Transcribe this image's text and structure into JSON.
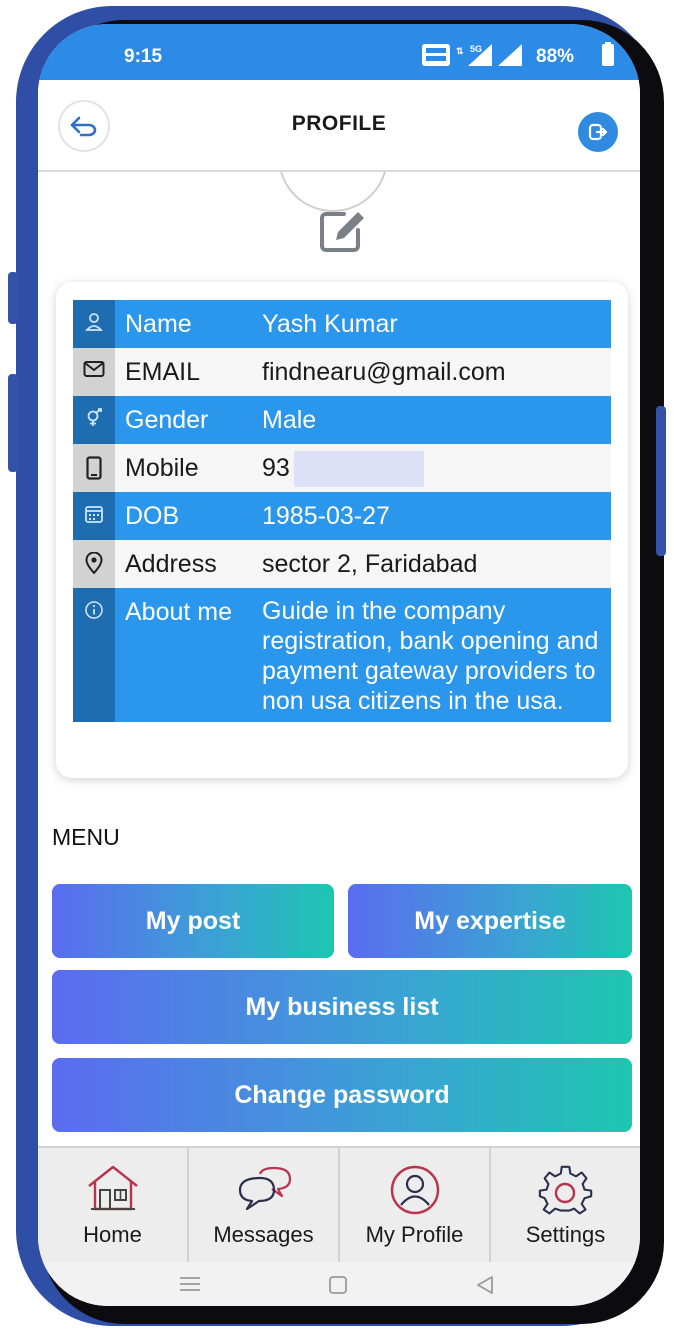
{
  "status_bar": {
    "time": "9:15",
    "network_label": "5G",
    "battery": "88%"
  },
  "header": {
    "title": "PROFILE"
  },
  "profile": {
    "rows": [
      {
        "label": "Name",
        "value": "Yash Kumar",
        "icon": "person-icon"
      },
      {
        "label": "EMAIL",
        "value": "findnearu@gmail.com",
        "icon": "mail-icon"
      },
      {
        "label": "Gender",
        "value": "Male",
        "icon": "gender-icon"
      },
      {
        "label": "Mobile",
        "value": "93",
        "icon": "phone-icon"
      },
      {
        "label": "DOB",
        "value": "1985-03-27",
        "icon": "calendar-icon"
      },
      {
        "label": "Address",
        "value": "sector 2, Faridabad",
        "icon": "location-pin-icon"
      },
      {
        "label": "About me",
        "value": "Guide in the company registration, bank opening and payment gateway providers to non usa citizens in the usa.",
        "icon": "info-icon"
      }
    ]
  },
  "menu": {
    "title": "MENU",
    "buttons": [
      "My post",
      "My expertise",
      "My business list",
      "Change password"
    ]
  },
  "bottom_nav": {
    "items": [
      {
        "label": "Home",
        "icon": "home-icon"
      },
      {
        "label": "Messages",
        "icon": "chat-icon"
      },
      {
        "label": "My Profile",
        "icon": "profile-icon"
      },
      {
        "label": "Settings",
        "icon": "gear-icon"
      }
    ]
  },
  "colors": {
    "status_bar": "#2d8be8",
    "row_blue": "#2a96ec",
    "row_icon_blue": "#1f6db1",
    "gradient_start": "#5b6cf0",
    "gradient_end": "#1dc6b0",
    "nav_icon": "#c0304a"
  }
}
